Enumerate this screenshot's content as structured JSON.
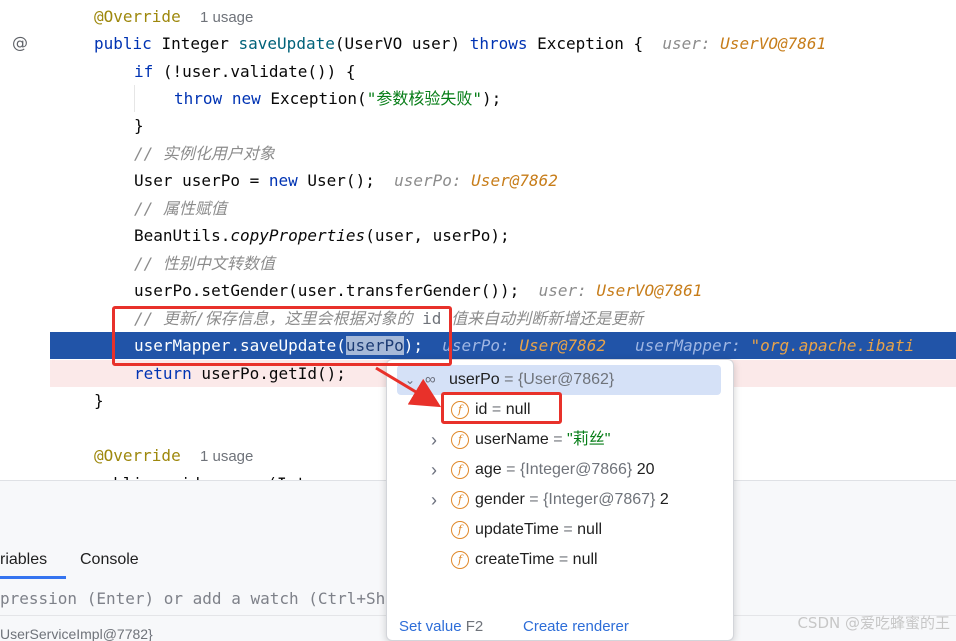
{
  "editor": {
    "line1": {
      "annotation": "@Override",
      "usage": "1 usage"
    },
    "line2": {
      "public": "public",
      "type": "Integer",
      "method": "saveUpdate",
      "params": "(UserVO user) ",
      "throws": "throws",
      "rest": " Exception {",
      "hint_key": "user:",
      "hint_val": "UserVO@7861"
    },
    "line3": {
      "if": "if",
      "rest": " (!user.validate()) {"
    },
    "line4": {
      "throw": "throw",
      "new": "new",
      "cls": " Exception(",
      "str": "\"参数核验失败\"",
      "end": ");"
    },
    "line5": {
      "text": "}"
    },
    "line6": {
      "comment": "// 实例化用户对象"
    },
    "line7": {
      "decl": "User userPo = ",
      "new": "new",
      "rest": " User();",
      "hint_key": "userPo:",
      "hint_val": "User@7862"
    },
    "line8": {
      "comment": "// 属性赋值"
    },
    "line9": {
      "cls": "BeanUtils.",
      "method": "copyProperties",
      "rest": "(user, userPo);"
    },
    "line10": {
      "comment": "// 性别中文转数值"
    },
    "line11": {
      "text": "userPo.setGender(user.transferGender());",
      "hint_key": "user:",
      "hint_val": "UserVO@7861"
    },
    "line12": {
      "comment_a": "// 更新/保存信息，这里会根据对象的 ",
      "comment_id": "id",
      "comment_b": " 值来自动判断新增还是更新"
    },
    "line13": {
      "pre": "userMapper.saveUpdate(",
      "sel": "userPo",
      "post": ");",
      "hint1_key": "userPo:",
      "hint1_val": "User@7862",
      "hint2_key": "userMapper:",
      "hint2_val": "\"org.apache.ibati"
    },
    "line14": {
      "return": "return",
      "rest": " userPo.getId();"
    },
    "line15": {
      "text": "}"
    },
    "line17": {
      "annotation": "@Override",
      "usage": "1 usage"
    },
    "line18": {
      "text": "public void remove(Int"
    }
  },
  "gutter": {
    "at_icon": "@"
  },
  "panel": {
    "tab_variables": "riables",
    "tab_console": "Console",
    "watch_placeholder": "pression (Enter) or add a watch (Ctrl+Shift",
    "frame": "UserServiceImpl@7782}"
  },
  "popup": {
    "root": {
      "name": "userPo",
      "eq": " = ",
      "ref": "{User@7862}"
    },
    "fields": [
      {
        "name": "id",
        "eq": " = ",
        "ref": "",
        "value": "null",
        "expandable": false
      },
      {
        "name": "userName",
        "eq": " = ",
        "ref": "",
        "value": "\"莉丝\"",
        "expandable": true
      },
      {
        "name": "age",
        "eq": " = ",
        "ref": "{Integer@7866} ",
        "value": "20",
        "expandable": true
      },
      {
        "name": "gender",
        "eq": " = ",
        "ref": "{Integer@7867} ",
        "value": "2",
        "expandable": true
      },
      {
        "name": "updateTime",
        "eq": " = ",
        "ref": "",
        "value": "null",
        "expandable": false
      },
      {
        "name": "createTime",
        "eq": " = ",
        "ref": "",
        "value": "null",
        "expandable": false
      }
    ],
    "field_icon": "f",
    "footer": {
      "set_value": "Set value",
      "set_value_key": "F2",
      "create_renderer": "Create renderer"
    }
  },
  "watermark": "CSDN @爱吃蜂蜜的王",
  "colors": {
    "highlight": "#2154a8",
    "annotation_red": "#e8312a",
    "keyword": "#0033b3",
    "string": "#067d17",
    "field_icon": "#e0892b"
  }
}
